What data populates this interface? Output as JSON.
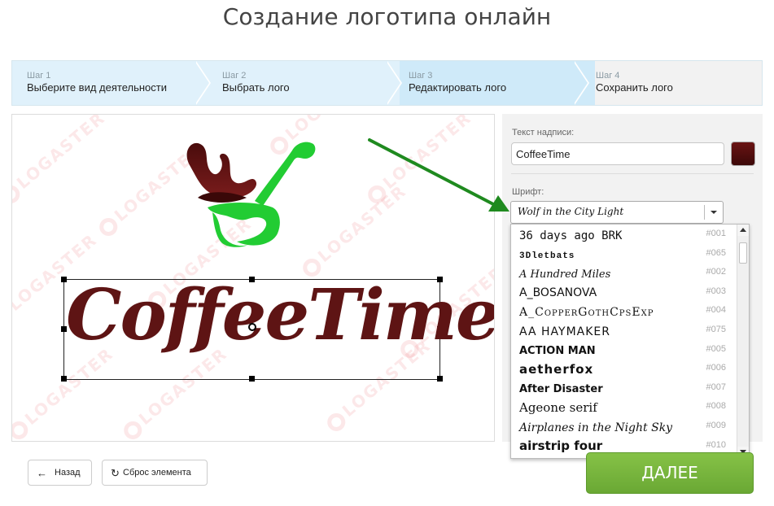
{
  "page": {
    "title": "Создание логотипа онлайн"
  },
  "steps": [
    {
      "num": "Шаг 1",
      "label": "Выберите вид деятельности"
    },
    {
      "num": "Шаг 2",
      "label": "Выбрать лого"
    },
    {
      "num": "Шаг 3",
      "label": "Редактировать лого"
    },
    {
      "num": "Шаг 4",
      "label": "Сохранить лого"
    }
  ],
  "canvas": {
    "watermark_text": "LOGASTER",
    "logo_text": "CoffeeTime",
    "logo_text_color": "#5e1414",
    "icon_colors": {
      "splash": "#5e1414",
      "cup": "#22cc33"
    }
  },
  "panel": {
    "text_label": "Текст надписи:",
    "text_value": "CoffeeTime",
    "text_color": "#5a1010",
    "font_label": "Шрифт:",
    "font_selected": "Wolf in the City Light"
  },
  "font_list": [
    {
      "name": "36 days ago BRK",
      "code": "#001"
    },
    {
      "name": "3Dletbats",
      "code": "#065"
    },
    {
      "name": "A Hundred Miles",
      "code": "#002"
    },
    {
      "name": "A_BOSANOVA",
      "code": "#003"
    },
    {
      "name": "A_CopperGothCpsExp",
      "code": "#004"
    },
    {
      "name": "AA HAYMAKER",
      "code": "#075"
    },
    {
      "name": "ACTION MAN",
      "code": "#005"
    },
    {
      "name": "aetherfox",
      "code": "#006"
    },
    {
      "name": "After Disaster",
      "code": "#007"
    },
    {
      "name": "Ageone serif",
      "code": "#008"
    },
    {
      "name": "Airplanes in the Night Sky",
      "code": "#009"
    },
    {
      "name": "airstrip four",
      "code": "#010"
    }
  ],
  "buttons": {
    "back": "Назад",
    "reset": "Сброс элемента",
    "next": "ДАЛЕЕ"
  },
  "colors": {
    "accent_green": "#6aa834",
    "pointer_arrow": "#1f8a1f"
  }
}
